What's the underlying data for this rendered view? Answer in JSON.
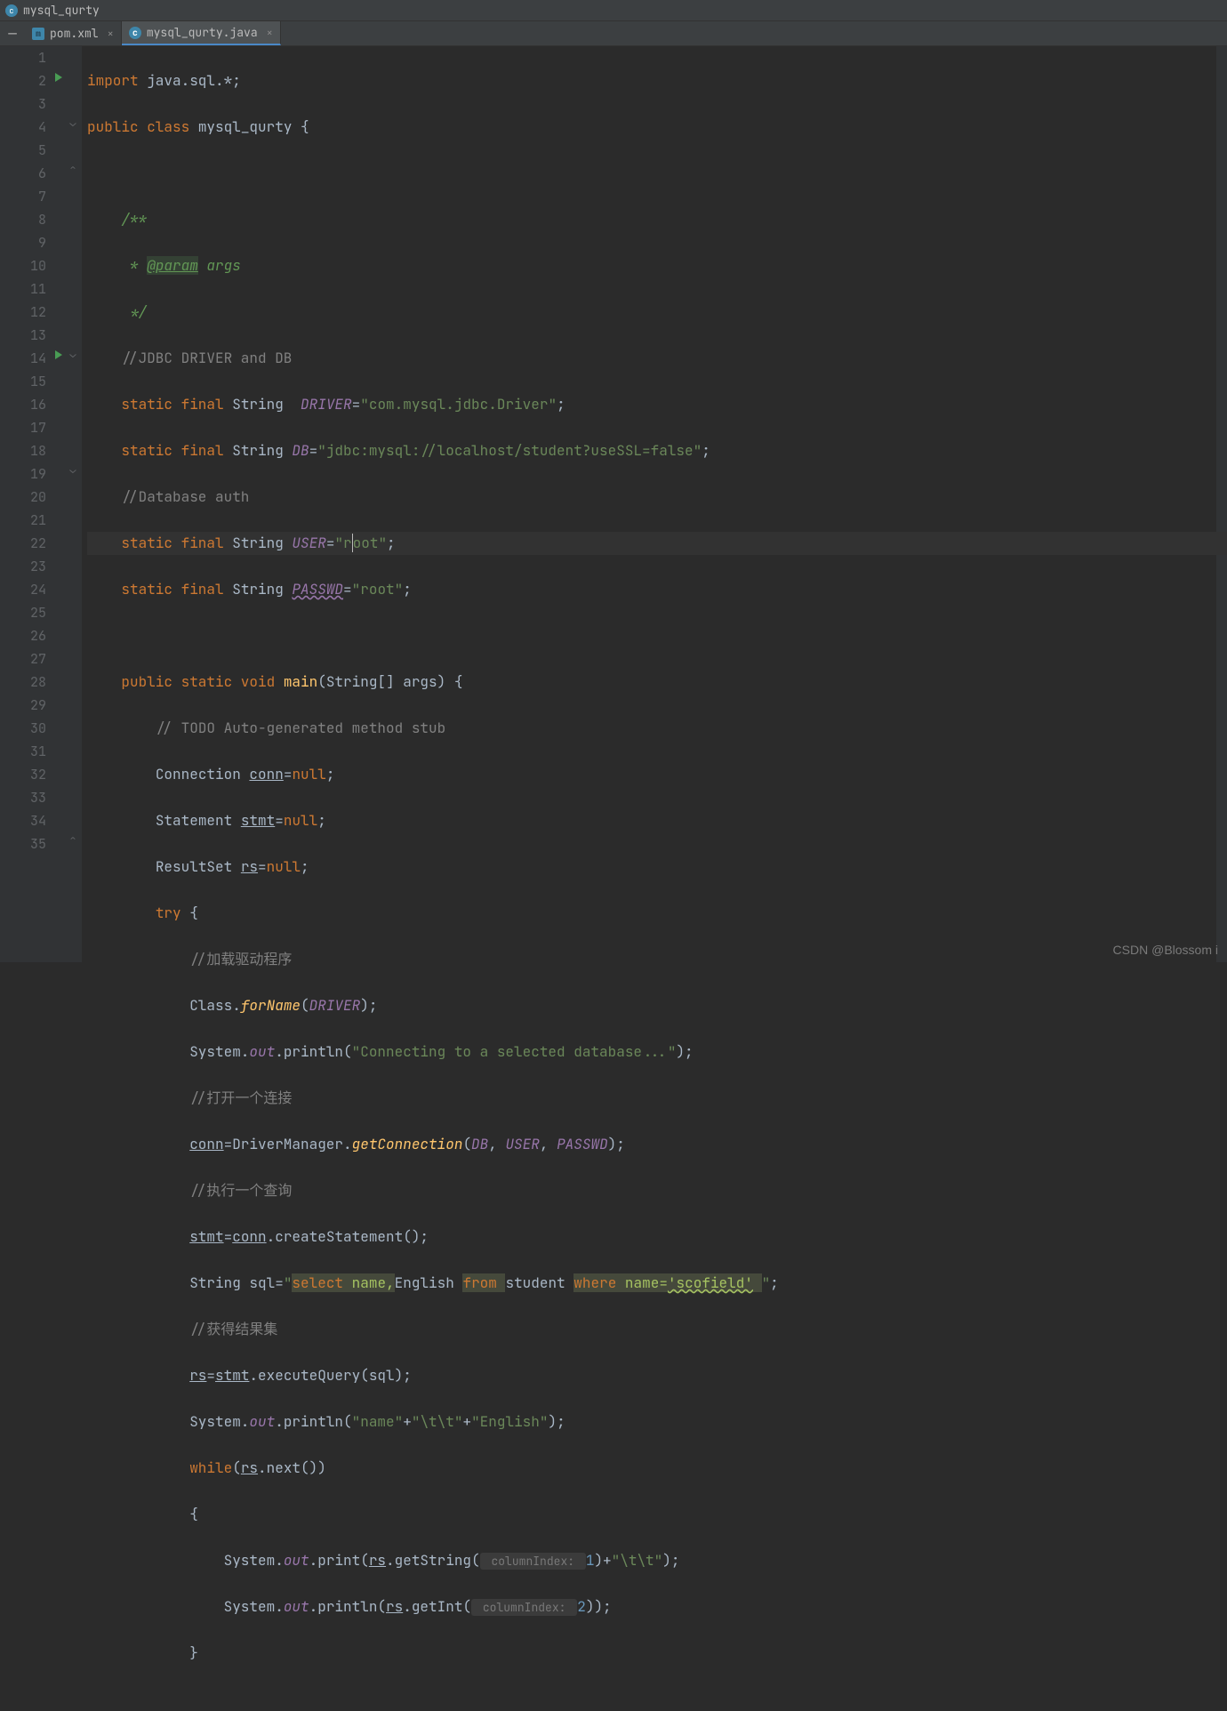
{
  "window": {
    "title": "mysql_qurty"
  },
  "sidemarker": "4.2",
  "tabs": [
    {
      "icon": "m",
      "label": "pom.xml",
      "active": false
    },
    {
      "icon": "c",
      "label": "mysql_qurty.java",
      "active": true
    }
  ],
  "gutter": {
    "lines": [
      "1",
      "2",
      "3",
      "4",
      "5",
      "6",
      "7",
      "8",
      "9",
      "10",
      "11",
      "12",
      "13",
      "14",
      "15",
      "16",
      "17",
      "18",
      "19",
      "20",
      "21",
      "22",
      "23",
      "24",
      "25",
      "26",
      "27",
      "28",
      "29",
      "30",
      "31",
      "32",
      "33",
      "34",
      "35"
    ],
    "run_markers": [
      2,
      14
    ],
    "bulb_marker": 11
  },
  "code": {
    "l1": {
      "kw1": "import",
      "txt": " java.sql.*;"
    },
    "l2": {
      "kw1": "public class ",
      "cls": "mysql_qurty",
      "brace": " {"
    },
    "l4": {
      "doc": "/**"
    },
    "l5": {
      "pre": " * ",
      "tag": "@param",
      "post": " args"
    },
    "l6": {
      "doc": " */"
    },
    "l7": {
      "cmt": "//JDBC DRIVER and DB"
    },
    "l8": {
      "kw": "static final ",
      "type": "String  ",
      "fld": "DRIVER",
      "eq": "=",
      "str": "\"com.mysql.jdbc.Driver\"",
      "semi": ";"
    },
    "l9": {
      "kw": "static final ",
      "type": "String ",
      "fld": "DB",
      "eq": "=",
      "str": "\"jdbc:mysql://localhost/student?useSSL=false\"",
      "semi": ";"
    },
    "l10": {
      "cmt": "//Database auth"
    },
    "l11": {
      "kw": "static final ",
      "type": "String ",
      "fld": "USER",
      "eq": "=",
      "str1": "\"r",
      "str2": "oot\"",
      "semi": ";"
    },
    "l12": {
      "kw": "static final ",
      "type": "String ",
      "fld": "PASSWD",
      "eq": "=",
      "str": "\"root\"",
      "semi": ";"
    },
    "l14": {
      "kw": "public static void ",
      "mtd": "main",
      "sig": "(String[] args) {"
    },
    "l15": {
      "cmt": "// TODO Auto-generated method stub"
    },
    "l16": {
      "type": "Connection ",
      "var": "conn",
      "rest": "=",
      "kw2": "null",
      "semi": ";"
    },
    "l17": {
      "type": "Statement ",
      "var": "stmt",
      "rest": "=",
      "kw2": "null",
      "semi": ";"
    },
    "l18": {
      "type": "ResultSet ",
      "var": "rs",
      "rest": "=",
      "kw2": "null",
      "semi": ";"
    },
    "l19": {
      "kw": "try ",
      "brace": "{"
    },
    "l20": {
      "cmt": "//加载驱动程序"
    },
    "l21": {
      "pre": "Class.",
      "mtd": "forName",
      "lp": "(",
      "fld": "DRIVER",
      "rp": ");"
    },
    "l22": {
      "pre": "System.",
      "out": "out",
      "dot": ".println(",
      "str": "\"Connecting to a selected database...\"",
      "rp": ");"
    },
    "l23": {
      "cmt": "//打开一个连接"
    },
    "l24": {
      "var": "conn",
      "eq": "=DriverManager.",
      "mtd": "getConnection",
      "lp": "(",
      "f1": "DB",
      "c1": ", ",
      "f2": "USER",
      "c2": ", ",
      "f3": "PASSWD",
      "rp": ");"
    },
    "l25": {
      "cmt": "//执行一个查询"
    },
    "l26": {
      "var": "stmt",
      "eq": "=",
      "var2": "conn",
      "rest": ".createStatement();"
    },
    "l27": {
      "type": "String sql=",
      "q1": "\"",
      "sql1": "select",
      "sp1": " ",
      "sql2": "name,",
      "plain": "English ",
      "sql3": "from",
      "sp2": " ",
      "sql4": "student ",
      "sql5": "where",
      "sp3": " ",
      "sql6": "name=",
      "lit": "'scofield'",
      "sp4": " ",
      "q2": "\"",
      "semi": ";"
    },
    "l28": {
      "cmt": "//获得结果集"
    },
    "l29": {
      "var": "rs",
      "eq": "=",
      "var2": "stmt",
      "rest": ".executeQuery(sql);"
    },
    "l30": {
      "pre": "System.",
      "out": "out",
      "dot": ".println(",
      "s1": "\"name\"",
      "p1": "+",
      "s2": "\"\\t\\t\"",
      "p2": "+",
      "s3": "\"English\"",
      "rp": ");"
    },
    "l31": {
      "kw": "while",
      "lp": "(",
      "var": "rs",
      "rest": ".next())"
    },
    "l32": {
      "brace": "{"
    },
    "l33": {
      "pre": "System.",
      "out": "out",
      "dot": ".print(",
      "var": "rs",
      "call": ".getString(",
      "hint": " columnIndex: ",
      "num": "1",
      "rp": ")+",
      "str": "\"\\t\\t\"",
      "end": ");"
    },
    "l34": {
      "pre": "System.",
      "out": "out",
      "dot": ".println(",
      "var": "rs",
      "call": ".getInt(",
      "hint": " columnIndex: ",
      "num": "2",
      "rp": "));"
    },
    "l35": {
      "brace": "}"
    }
  },
  "watermark": "CSDN @Blossom i"
}
